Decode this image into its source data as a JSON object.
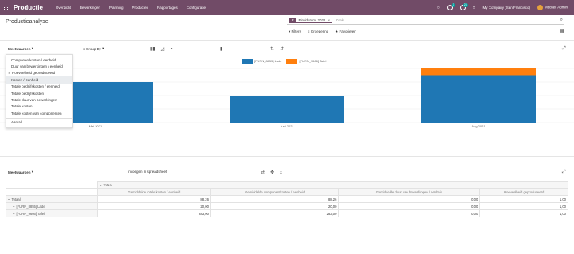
{
  "navbar": {
    "app_name": "Productie",
    "menu": [
      "Overzicht",
      "Bewerkingen",
      "Planning",
      "Producten",
      "Rapportages",
      "Configuratie"
    ],
    "chat_count": "7",
    "activity_count": "24",
    "company": "My Company (San Francisco)",
    "user": "Mitchell Admin"
  },
  "page": {
    "title": "Productieanalyse"
  },
  "search": {
    "facet_value": "Einddatum: 2021",
    "placeholder": "Zoek..."
  },
  "filters": {
    "filters_label": "Filters",
    "groupby_label": "Groepering",
    "favorites_label": "Favorieten"
  },
  "graph_toolbar": {
    "measures_label": "Meetwaarden",
    "groupby_label": "Group By"
  },
  "measures_dropdown": [
    {
      "label": "Componentkosten / eenheid",
      "checked": false,
      "highlight": false
    },
    {
      "label": "Duur van bewerkingen / eenheid",
      "checked": false,
      "highlight": false
    },
    {
      "label": "Hoeveelheid geproduceerd",
      "checked": true,
      "highlight": false
    },
    {
      "label": "Kosten / Eenheid",
      "checked": false,
      "highlight": true
    },
    {
      "label": "Totale bedrijfskosten / eenheid",
      "checked": false,
      "highlight": false
    },
    {
      "label": "Totale bedrijfskosten",
      "checked": false,
      "highlight": false
    },
    {
      "label": "Totale duur van bewerkingen",
      "checked": false,
      "highlight": false
    },
    {
      "label": "Totale kosten",
      "checked": false,
      "highlight": false
    },
    {
      "label": "Totale kosten van componenten",
      "checked": false,
      "highlight": false
    },
    {
      "label": "Aantal",
      "checked": false,
      "highlight": false,
      "separator_before": true
    }
  ],
  "chart_data": {
    "type": "bar",
    "stacked": true,
    "categories": [
      "Mei 2021",
      "Juni 2021",
      "Aug 2021"
    ],
    "series": [
      {
        "name": "[FURN_8855] Lade",
        "color": "#1f77b4",
        "values": [
          6,
          4,
          7
        ]
      },
      {
        "name": "[FURN_9666] Tafel",
        "color": "#ff7f0e",
        "values": [
          0,
          0,
          1
        ]
      }
    ],
    "ylim": [
      0,
      8
    ],
    "legend": "top"
  },
  "pivot": {
    "measures_label": "Meetwaarden",
    "insert_label": "Invoegen in spreadsheet",
    "col_header": "Totaal",
    "measures": [
      "Gemiddelde totale kosten / eenheid",
      "Gemiddelde componentkosten / eenheid",
      "Gemiddelde duur van bewerkingen / eenheid",
      "Hoeveelheid geproduceerd"
    ],
    "rows": [
      {
        "label": "Totaal",
        "expander": "−",
        "values": [
          "88,26",
          "88,26",
          "0,00",
          "1,00"
        ]
      },
      {
        "label": "[FURN_8855] Lade",
        "expander": "+",
        "values": [
          "20,00",
          "20,00",
          "0,00",
          "1,00"
        ]
      },
      {
        "label": "[FURN_9666] Tafel",
        "expander": "+",
        "values": [
          "283,00",
          "283,00",
          "0,00",
          "1,00"
        ]
      }
    ]
  }
}
